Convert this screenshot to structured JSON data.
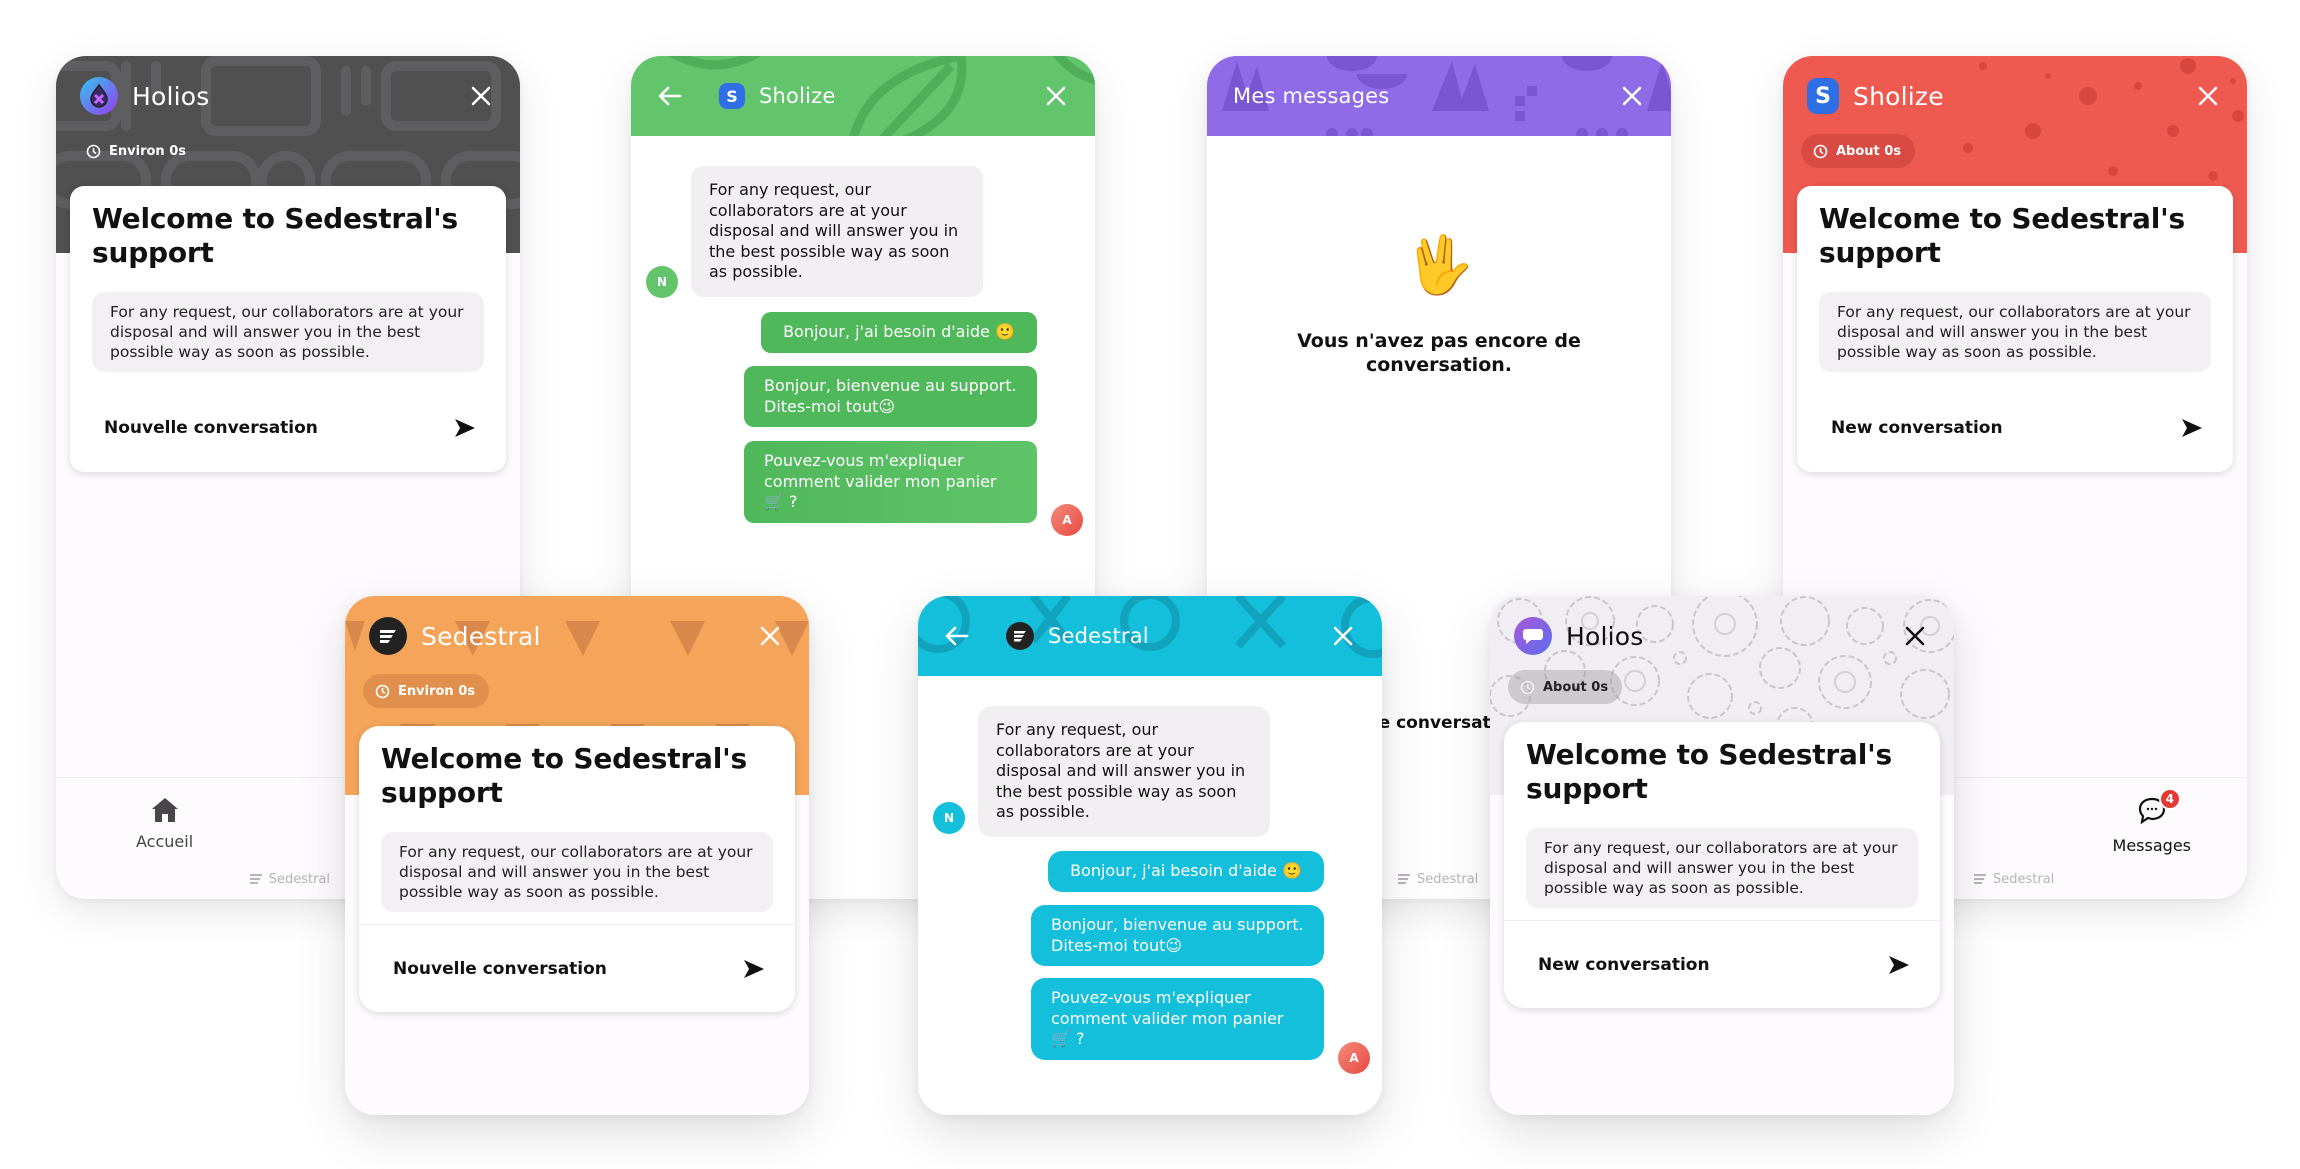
{
  "colors": {
    "holios_dark": "#505051",
    "sholize_green": "#62c46b",
    "green_bubble": "#4fb85a",
    "purple": "#8f6be8",
    "red": "#ef5a50",
    "orange": "#f5a55a",
    "cyan": "#14bfdc",
    "gears_bg": "#f0eef2",
    "avatar_user": "#ef5a50"
  },
  "welcome": {
    "title": "Welcome to Sedestral's support",
    "description": "For any request, our collaborators are at your disposal and will answer you in the best possible way as soon as possible."
  },
  "panels": {
    "holios_dark": {
      "brand": "Holios",
      "eta": "Environ 0s",
      "cta": "Nouvelle conversation",
      "nav": {
        "home_label": "Accueil"
      },
      "powered_by": "Sedestral"
    },
    "sholize_green": {
      "brand": "Sholize",
      "logo_letter": "S",
      "messages": [
        {
          "from": "agent",
          "avatar": "N",
          "text": "For any request, our collaborators are at your disposal and will answer you in the best possible way as soon as possible."
        },
        {
          "from": "user",
          "text": "Bonjour, j'ai besoin d'aide 🙂"
        },
        {
          "from": "user",
          "text": "Bonjour, bienvenue au support. Dites-moi tout😉"
        },
        {
          "from": "user",
          "avatar": "A",
          "text": "Pouvez-vous m'expliquer comment valider mon panier 🛒 ?"
        }
      ]
    },
    "purple": {
      "title": "Mes messages",
      "empty_emoji": "🖖",
      "empty_text": "Vous n'avez pas encore de conversation.",
      "partial_cta": "lle conversat",
      "powered_by": "Sedestral"
    },
    "sholize_red": {
      "brand": "Sholize",
      "logo_letter": "S",
      "eta": "About 0s",
      "cta": "New conversation",
      "nav": {
        "messages_label": "Messages",
        "messages_badge": "4"
      },
      "powered_by": "Sedestral"
    },
    "sedestral_orange": {
      "brand": "Sedestral",
      "eta": "Environ 0s",
      "cta": "Nouvelle conversation"
    },
    "sedestral_cyan": {
      "brand": "Sedestral",
      "messages": [
        {
          "from": "agent",
          "avatar": "N",
          "text": "For any request, our collaborators are at your disposal and will answer you in the best possible way as soon as possible."
        },
        {
          "from": "user",
          "text": "Bonjour, j'ai besoin d'aide 🙂"
        },
        {
          "from": "user",
          "text": "Bonjour, bienvenue au support. Dites-moi tout😉"
        },
        {
          "from": "user",
          "avatar": "A",
          "text": "Pouvez-vous m'expliquer comment valider mon panier 🛒 ?"
        }
      ]
    },
    "holios_gears": {
      "brand": "Holios",
      "eta": "About 0s",
      "cta": "New conversation"
    }
  }
}
